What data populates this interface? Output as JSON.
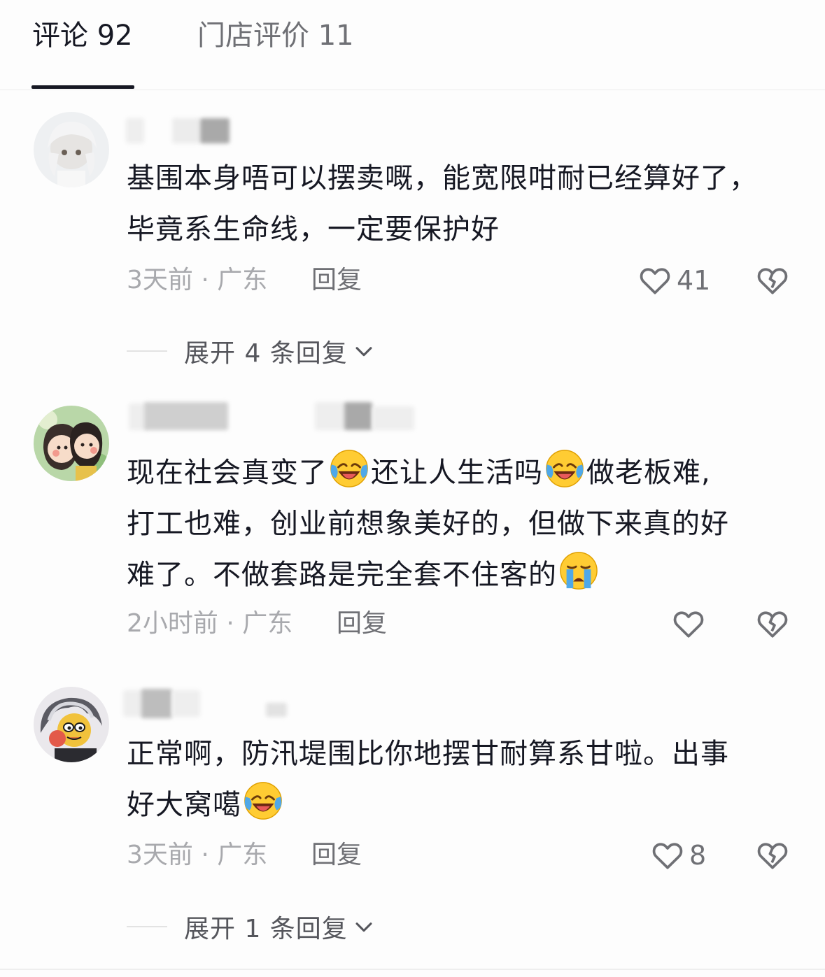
{
  "tabs": {
    "comments": "评论 92",
    "store_reviews": "门店评价 11"
  },
  "comments": [
    {
      "text": "基围本身唔可以摆卖嘅，能宽限咁耐已经算好了，毕竟系生命线，一定要保护好",
      "meta": "3天前 · 广东",
      "reply_label": "回复",
      "likes": "41",
      "expand_label": "展开 4 条回复"
    },
    {
      "line1a": "现在社会真变了",
      "line1b": "还让人生活吗",
      "line1c": "做老板难,",
      "line2": "打工也难，创业前想象美好的，但做下来真的好",
      "line3": "难了。不做套路是完全套不住客的",
      "meta": "2小时前 · 广东",
      "reply_label": "回复",
      "likes": ""
    },
    {
      "line1": "正常啊，防汛堤围比你地摆甘耐算系甘啦。出事",
      "line2": "好大窝噶",
      "meta": "3天前 · 广东",
      "reply_label": "回复",
      "likes": "8",
      "expand_label": "展开 1 条回复"
    }
  ],
  "icons": {
    "like": "heart-outline-icon",
    "dislike": "broken-heart-icon",
    "expand": "chevron-down-icon",
    "emoji_laugh": "laughing-tears-emoji",
    "emoji_cry": "loudly-crying-emoji"
  }
}
